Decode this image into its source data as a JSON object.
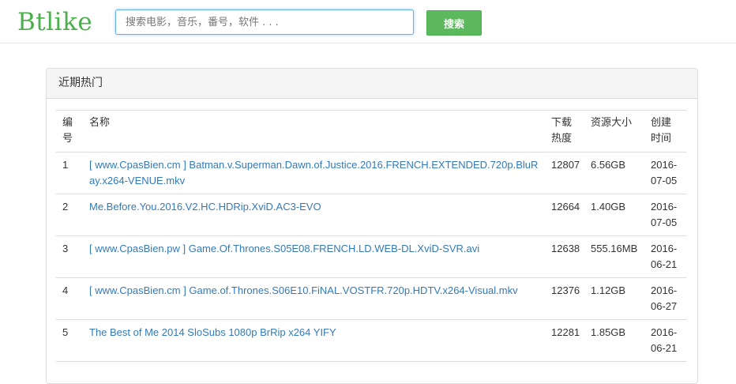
{
  "header": {
    "logo": "Btlike",
    "search_placeholder": "搜索电影，音乐，番号，软件 . . .",
    "search_button": "搜索"
  },
  "panel": {
    "title": "近期热门"
  },
  "table": {
    "columns": [
      "编号",
      "名称",
      "下载热度",
      "资源大小",
      "创建时间"
    ],
    "rows": [
      {
        "num": "1",
        "name": "[ www.CpasBien.cm ] Batman.v.Superman.Dawn.of.Justice.2016.FRENCH.EXTENDED.720p.BluRay.x264-VENUE.mkv",
        "heat": "12807",
        "size": "6.56GB",
        "date": "2016-07-05"
      },
      {
        "num": "2",
        "name": "Me.Before.You.2016.V2.HC.HDRip.XviD.AC3-EVO",
        "heat": "12664",
        "size": "1.40GB",
        "date": "2016-07-05"
      },
      {
        "num": "3",
        "name": "[ www.CpasBien.pw ] Game.Of.Thrones.S05E08.FRENCH.LD.WEB-DL.XviD-SVR.avi",
        "heat": "12638",
        "size": "555.16MB",
        "date": "2016-06-21"
      },
      {
        "num": "4",
        "name": "[ www.CpasBien.cm ] Game.of.Thrones.S06E10.FiNAL.VOSTFR.720p.HDTV.x264-Visual.mkv",
        "heat": "12376",
        "size": "1.12GB",
        "date": "2016-06-27"
      },
      {
        "num": "5",
        "name": "The Best of Me 2014 SloSubs 1080p BrRip x264 YIFY",
        "heat": "12281",
        "size": "1.85GB",
        "date": "2016-06-21"
      }
    ]
  },
  "colors": {
    "brand": "#4cae4c",
    "button": "#5cb85c",
    "link": "#337ab7"
  }
}
